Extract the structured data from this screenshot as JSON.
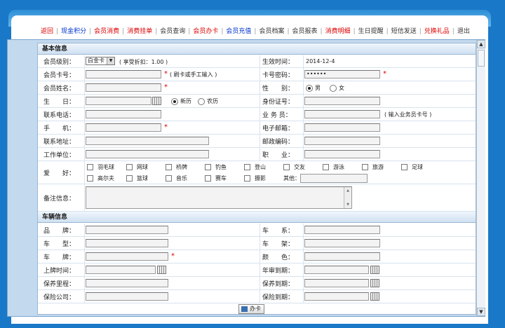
{
  "menu": [
    {
      "label": "返回",
      "color": "red"
    },
    {
      "label": "现金积分",
      "color": "blue"
    },
    {
      "label": "会员消费",
      "color": "red"
    },
    {
      "label": "消费挂单",
      "color": "red"
    },
    {
      "label": "会员查询",
      "color": "dk"
    },
    {
      "label": "会员办卡",
      "color": "red"
    },
    {
      "label": "会员充值",
      "color": "blue"
    },
    {
      "label": "会员档案",
      "color": "dk"
    },
    {
      "label": "会员报表",
      "color": "dk"
    },
    {
      "label": "消费明细",
      "color": "red"
    },
    {
      "label": "生日提醒",
      "color": "dk"
    },
    {
      "label": "短信发送",
      "color": "dk"
    },
    {
      "label": "兑换礼品",
      "color": "red"
    },
    {
      "label": "退出",
      "color": "dk"
    }
  ],
  "basic": {
    "title": "基本信息",
    "level_label": "会员级别：",
    "level_value": "白金卡",
    "discount": "( 享受折扣：1.00 )",
    "effective_label": "生效时间：",
    "effective_value": "2014-12-4",
    "card_label": "会员卡号：",
    "card_note": "( 刷卡或手工输入 )",
    "pwd_label": "卡号密码：",
    "pwd_value": "••••••",
    "name_label": "会员姓名：",
    "gender_label": "性　　别：",
    "male": "男",
    "female": "女",
    "birthday_label": "生　　日：",
    "solar": "新历",
    "lunar": "农历",
    "idcard_label": "身份证号：",
    "phone_label": "联系电话：",
    "staff_label": "业 务 员：",
    "staff_note": "( 输入业务员卡号 )",
    "mobile_label": "手　　机：",
    "email_label": "电子邮箱：",
    "address_label": "联系地址：",
    "zip_label": "邮政编码：",
    "company_label": "工作单位：",
    "job_label": "职　　业：",
    "hobby_label": "爱　　好：",
    "hobbies_row1": [
      "羽毛球",
      "网球",
      "桥牌",
      "钓鱼",
      "登山",
      "交友",
      "游泳",
      "旅游",
      "足球"
    ],
    "hobbies_row2": [
      "高尔夫",
      "篮球",
      "音乐",
      "赛车",
      "摄影"
    ],
    "other_label": "其他：",
    "remark_label": "备注信息："
  },
  "vehicle": {
    "title": "车辆信息",
    "brand_label": "品　　牌：",
    "series_label": "车　　系：",
    "model_label": "车　　型：",
    "frame_label": "车　　架：",
    "plate_label": "车　　牌：",
    "color_label": "颜　　色：",
    "reg_label": "上牌时间：",
    "inspect_label": "年审到期：",
    "mileage_label": "保养里程：",
    "maint_label": "保养到期：",
    "insurer_label": "保险公司：",
    "insure_label": "保险到期："
  },
  "submit_label": "办卡",
  "required_mark": "*"
}
